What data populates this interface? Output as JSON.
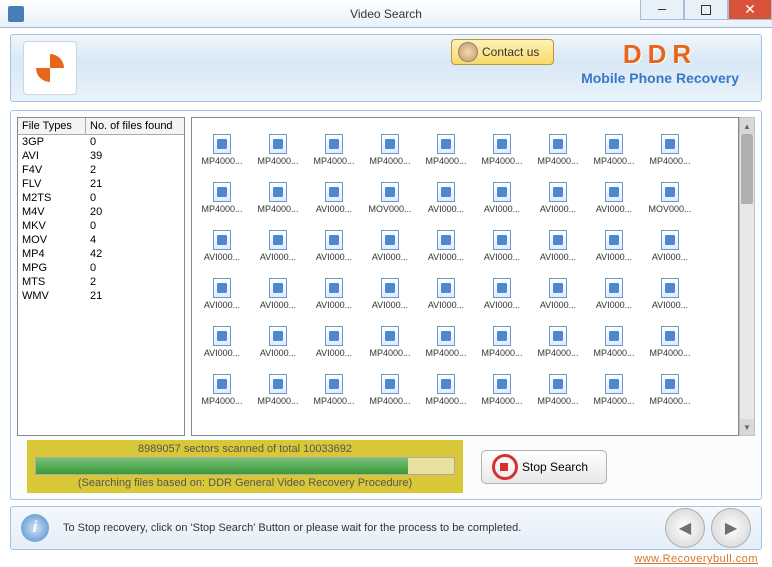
{
  "window": {
    "title": "Video Search"
  },
  "header": {
    "contact_label": "Contact us",
    "brand": {
      "ddr": "DDR",
      "sub": "Mobile Phone Recovery"
    }
  },
  "file_types": {
    "col1": "File Types",
    "col2": "No. of files found",
    "rows": [
      {
        "t": "3GP",
        "n": "0"
      },
      {
        "t": "AVI",
        "n": "39"
      },
      {
        "t": "F4V",
        "n": "2"
      },
      {
        "t": "FLV",
        "n": "21"
      },
      {
        "t": "M2TS",
        "n": "0"
      },
      {
        "t": "M4V",
        "n": "20"
      },
      {
        "t": "MKV",
        "n": "0"
      },
      {
        "t": "MOV",
        "n": "4"
      },
      {
        "t": "MP4",
        "n": "42"
      },
      {
        "t": "MPG",
        "n": "0"
      },
      {
        "t": "MTS",
        "n": "2"
      },
      {
        "t": "WMV",
        "n": "21"
      }
    ]
  },
  "files": [
    "MP4000...",
    "MP4000...",
    "MP4000...",
    "MP4000...",
    "MP4000...",
    "MP4000...",
    "MP4000...",
    "MP4000...",
    "MP4000...",
    "MP4000...",
    "MP4000...",
    "AVI000...",
    "MOV000...",
    "AVI000...",
    "AVI000...",
    "AVI000...",
    "AVI000...",
    "MOV000...",
    "AVI000...",
    "AVI000...",
    "AVI000...",
    "AVI000...",
    "AVI000...",
    "AVI000...",
    "AVI000...",
    "AVI000...",
    "AVI000...",
    "AVI000...",
    "AVI000...",
    "AVI000...",
    "AVI000...",
    "AVI000...",
    "AVI000...",
    "AVI000...",
    "AVI000...",
    "AVI000...",
    "AVI000...",
    "AVI000...",
    "AVI000...",
    "MP4000...",
    "MP4000...",
    "MP4000...",
    "MP4000...",
    "MP4000...",
    "MP4000...",
    "MP4000...",
    "MP4000...",
    "MP4000...",
    "MP4000...",
    "MP4000...",
    "MP4000...",
    "MP4000...",
    "MP4000...",
    "MP4000..."
  ],
  "progress": {
    "status": "8989057 sectors scanned of total 10033692",
    "searching": "(Searching files based on:  DDR General Video Recovery Procedure)",
    "stop_label": "Stop Search"
  },
  "footer": {
    "hint": "To Stop recovery, click on 'Stop Search' Button or please wait for the process to be completed."
  },
  "watermark": "www.Recoverybull.com"
}
